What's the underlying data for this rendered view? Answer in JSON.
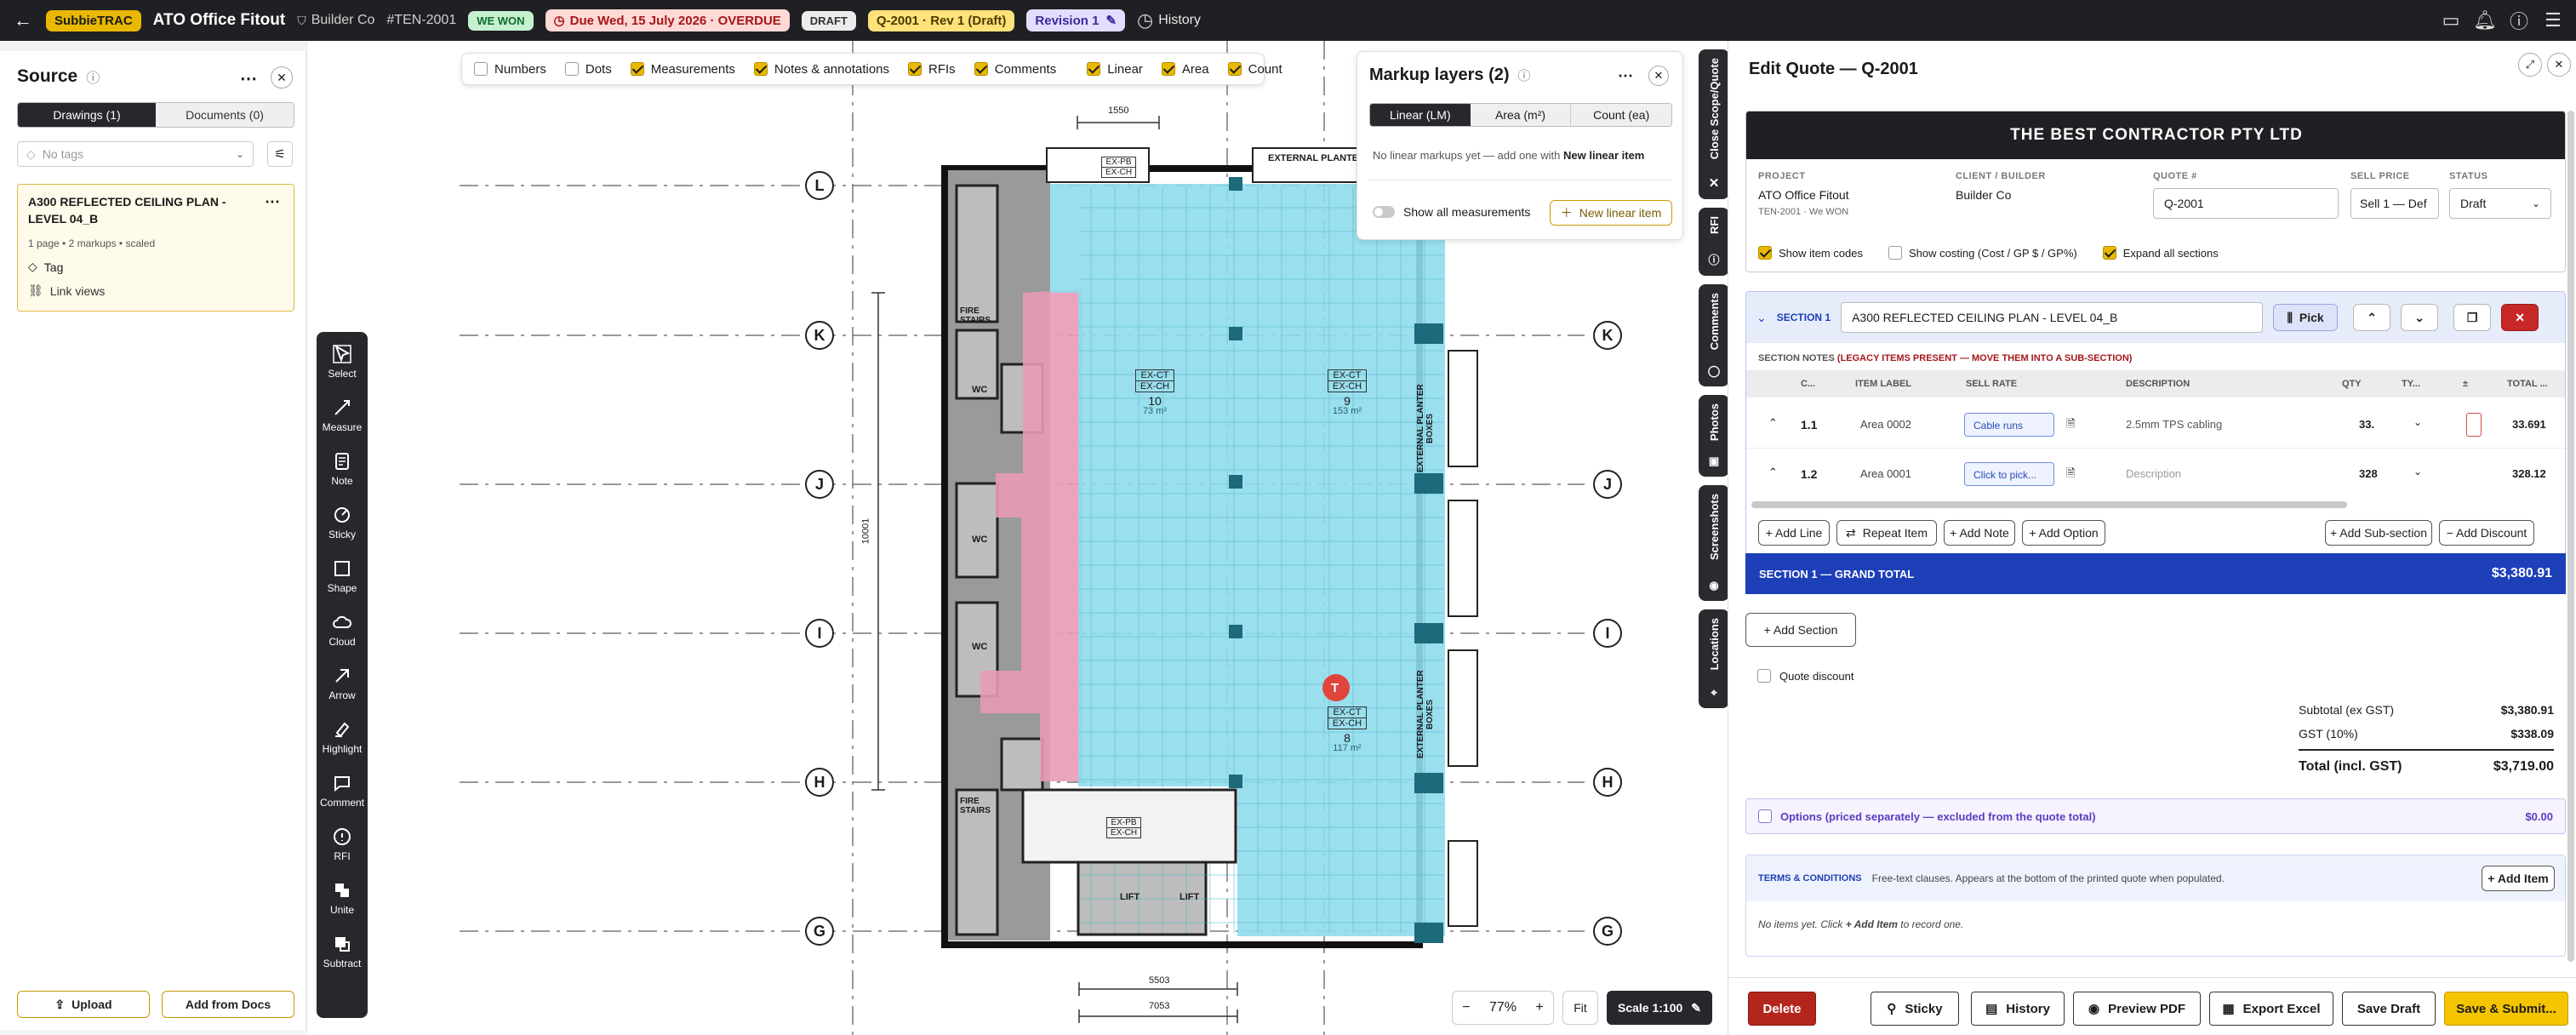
{
  "topbar": {
    "brand": "SubbieTRAC",
    "project": "ATO Office Fitout",
    "client": "Builder Co",
    "tender": "#TEN-2001",
    "won": "WE WON",
    "due": "Due Wed, 15 July 2026 · OVERDUE",
    "draft": "DRAFT",
    "quote_ref": "Q-2001 · Rev 1 (Draft)",
    "revision": "Revision 1",
    "history": "History"
  },
  "source": {
    "title": "Source",
    "tabs": [
      "Drawings (1)",
      "Documents (0)"
    ],
    "tags_placeholder": "No tags",
    "card": {
      "title": "A300 REFLECTED CEILING PLAN - LEVEL 04_B",
      "meta": "1 page • 2 markups • scaled",
      "tag": "Tag",
      "link": "Link views"
    },
    "upload": "Upload",
    "add_from_docs": "Add from Docs"
  },
  "toolbar": {
    "tools": [
      "Select",
      "Measure",
      "Note",
      "Sticky",
      "Shape",
      "Cloud",
      "Arrow",
      "Highlight",
      "Comment",
      "RFI",
      "Unite",
      "Subtract"
    ]
  },
  "filters": [
    {
      "label": "Numbers",
      "checked": false
    },
    {
      "label": "Dots",
      "checked": false
    },
    {
      "label": "Measurements",
      "checked": true
    },
    {
      "label": "Notes & annotations",
      "checked": true
    },
    {
      "label": "RFIs",
      "checked": true
    },
    {
      "label": "Comments",
      "checked": true
    },
    {
      "label": "Linear",
      "checked": true
    },
    {
      "label": "Area",
      "checked": true
    },
    {
      "label": "Count",
      "checked": true
    }
  ],
  "markup": {
    "title": "Markup layers (2)",
    "tabs": [
      "Linear (LM)",
      "Area (m²)",
      "Count (ea)"
    ],
    "empty_prefix": "No linear markups yet — add one with ",
    "empty_link": "New linear item",
    "show_all": "Show all measurements",
    "new_item": "New linear item"
  },
  "drawing": {
    "grid_labels": [
      "L",
      "K",
      "J",
      "I",
      "H",
      "G"
    ],
    "dims": [
      "1550",
      "10001",
      "5503",
      "7053"
    ],
    "rooms": [
      {
        "code1": "EX-CT",
        "code2": "EX-CH",
        "num": "10",
        "area": "73 m²"
      },
      {
        "code1": "EX-CT",
        "code2": "EX-CH",
        "num": "9",
        "area": "153 m²"
      },
      {
        "code1": "EX-CT",
        "code2": "EX-CH",
        "num": "8",
        "area": "117 m²"
      }
    ],
    "labels": {
      "ext_planter": "EXTERNAL PLANTER",
      "ext_planter_boxes": "EXTERNAL PLANTER BOXES",
      "fire_stairs": "FIRE STAIRS",
      "wc": "WC",
      "lift": "LIFT",
      "ex_pb": "EX-PB",
      "ex_ch": "EX-CH",
      "marker": "T"
    }
  },
  "zoom": {
    "minus": "−",
    "value": "77%",
    "plus": "+",
    "fit": "Fit",
    "scale": "Scale 1:100"
  },
  "sidetabs": [
    "Close Scope/Quote",
    "RFI",
    "Comments",
    "Photos",
    "Screenshots",
    "Locations"
  ],
  "quote": {
    "title": "Edit Quote — Q-2001",
    "company": "THE BEST CONTRACTOR PTY LTD",
    "project_label": "PROJECT",
    "project": "ATO Office Fitout",
    "project_sub": "TEN-2001 · We WON",
    "client_label": "CLIENT / BUILDER",
    "client": "Builder Co",
    "quote_label": "QUOTE #",
    "quote_no": "Q-2001",
    "sell_label": "SELL PRICE",
    "sell": "Sell 1 — Def",
    "status_label": "STATUS",
    "status": "Draft",
    "opt_codes": "Show item codes",
    "opt_costing": "Show costing (Cost / GP $ / GP%)",
    "opt_expand": "Expand all sections",
    "section_label": "SECTION 1",
    "section_name": "A300 REFLECTED CEILING PLAN - LEVEL 04_B",
    "pick": "Pick",
    "notes_prefix": "SECTION NOTES",
    "notes_warn": "(LEGACY ITEMS PRESENT — MOVE THEM INTO A SUB-SECTION)",
    "columns": [
      "C...",
      "ITEM LABEL",
      "SELL RATE",
      "DESCRIPTION",
      "QTY",
      "TY...",
      "±",
      "TOTAL ..."
    ],
    "rows": [
      {
        "code": "1.1",
        "label": "Area 0002",
        "rate": "Cable runs",
        "desc": "2.5mm TPS cabling",
        "qty": "33.",
        "total": "33.691"
      },
      {
        "code": "1.2",
        "label": "Area 0001",
        "rate": "Click to pick...",
        "desc": "Description",
        "qty": "328",
        "total": "328.12"
      }
    ],
    "actions": [
      "+ Add Line",
      "Repeat Item",
      "+ Add Note",
      "+ Add Option",
      "+ Add Sub-section",
      "− Add Discount"
    ],
    "grand_label": "SECTION 1 — GRAND TOTAL",
    "grand_value": "$3,380.91",
    "add_section": "+ Add Section",
    "discount": "Quote discount",
    "subtotal_label": "Subtotal (ex GST)",
    "subtotal": "$3,380.91",
    "gst_label": "GST (10%)",
    "gst": "$338.09",
    "total_label": "Total (incl. GST)",
    "total": "$3,719.00",
    "options": "Options (priced separately — excluded from the quote total)",
    "options_value": "$0.00",
    "terms_label": "TERMS & CONDITIONS",
    "terms_desc": "Free-text clauses. Appears at the bottom of the printed quote when populated.",
    "add_item": "+ Add Item",
    "no_items_prefix": "No items yet. Click ",
    "no_items_link": "+ Add Item",
    "no_items_suffix": " to record one."
  },
  "footer": {
    "delete": "Delete",
    "sticky": "Sticky",
    "history": "History",
    "preview": "Preview PDF",
    "export": "Export Excel",
    "save_draft": "Save Draft",
    "save_submit": "Save & Submit..."
  },
  "colors": {
    "accent": "#e9b800",
    "section_blue": "#1d3fb8",
    "delete_red": "#b3261e",
    "area_blue": "#8fdcec",
    "area_pink": "#e89ab5"
  }
}
